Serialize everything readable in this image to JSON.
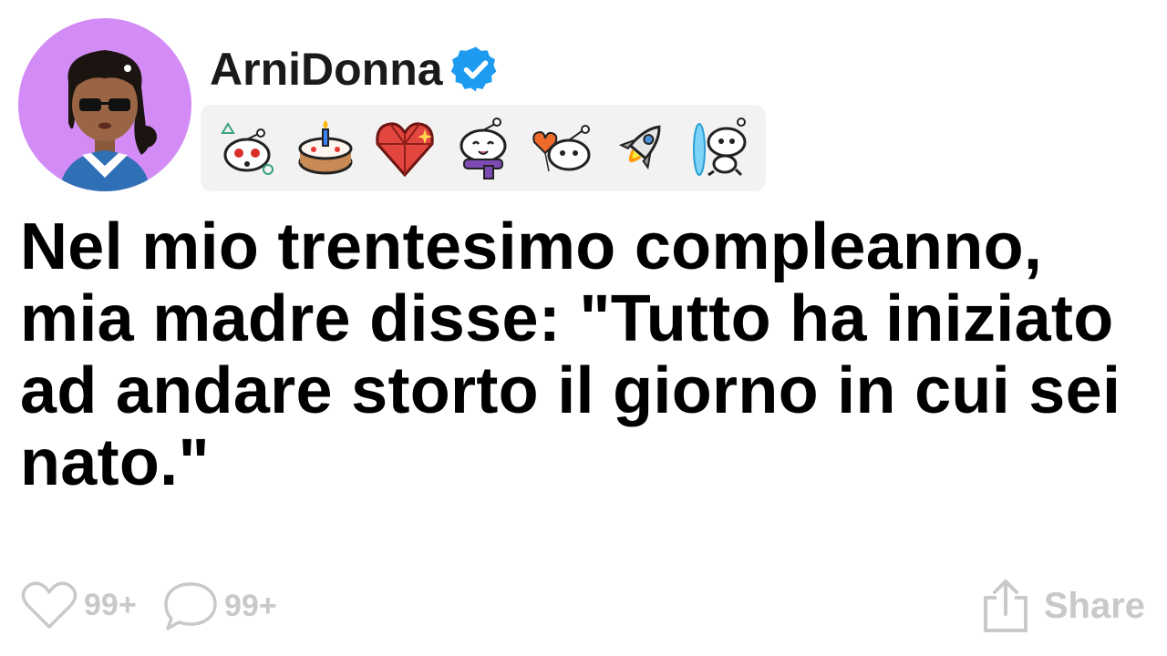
{
  "post": {
    "username": "ArniDonna",
    "verified": true,
    "title": "Nel mio trentesimo compleanno, mia madre disse: \"Tutto ha iniziato ad andare storto il giorno in cui sei nato.\""
  },
  "badges": [
    "snoo-shocked-icon",
    "birthday-cake-icon",
    "gem-heart-icon",
    "snoo-scarf-icon",
    "snoo-heart-balloons-icon",
    "rocket-icon",
    "snoo-portal-icon"
  ],
  "footer": {
    "likes": "99+",
    "comments": "99+",
    "share_label": "Share"
  },
  "colors": {
    "avatar_bg": "#d38cf6",
    "verified_blue": "#1d9bf0",
    "muted": "#c9c9c9",
    "badge_bg": "#f2f2f2"
  }
}
